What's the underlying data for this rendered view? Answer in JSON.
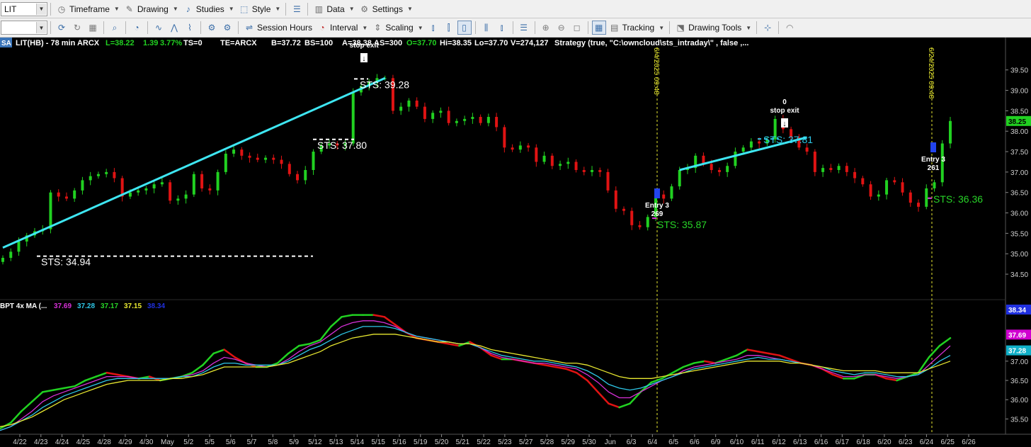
{
  "toolbar1": {
    "symbol_value": "LIT",
    "items": [
      {
        "id": "timeframe",
        "label": "Timeframe",
        "icon": "clock-icon"
      },
      {
        "id": "drawing",
        "label": "Drawing",
        "icon": "pencil-icon"
      },
      {
        "id": "studies",
        "label": "Studies",
        "icon": "studies-icon"
      },
      {
        "id": "style",
        "label": "Style",
        "icon": "style-icon"
      },
      {
        "id": "data",
        "label": "Data",
        "icon": "data-icon"
      },
      {
        "id": "settings",
        "label": "Settings",
        "icon": "gear-icon"
      }
    ]
  },
  "toolbar2": {
    "combo_value": "",
    "session_hours": "Session Hours",
    "interval": "Interval",
    "scaling": "Scaling",
    "tracking": "Tracking",
    "drawing_tools": "Drawing Tools"
  },
  "header": {
    "badge": "SA",
    "symbol": "LIT(HB) - 78 min  ARCX",
    "last": "L=38.22",
    "change": "1.39",
    "change_pct": "3.77%",
    "ts": "TS=0",
    "te": "TE=ARCX",
    "bid": "B=37.72",
    "bid_size": "BS=100",
    "ask": "A=38.38",
    "ask_size": "AS=300",
    "open": "O=37.70",
    "high": "Hi=38.35",
    "low": "Lo=37.70",
    "volume": "V=274,127",
    "strategy": "Strategy (true, \"C:\\owncloud\\sts_intraday\\\" , false ,..."
  },
  "colors": {
    "up": "#21d121",
    "down": "#e01313",
    "trend": "#3ee6f2",
    "green_text": "#28d428",
    "yellow": "#e8e830",
    "blue": "#2244ee",
    "magenta": "#d830d8"
  },
  "chart_data": {
    "type": "candlestick",
    "symbol": "LIT",
    "price_axis": {
      "ticks": [
        "39.50",
        "39.00",
        "38.50",
        "38.00",
        "37.50",
        "37.00",
        "36.50",
        "36.00",
        "35.50",
        "35.00",
        "34.50"
      ],
      "range": [
        34.05,
        40.05
      ],
      "current_price_label": "38.25"
    },
    "indicator_axis": {
      "ticks": [
        "37.00",
        "36.50",
        "36.00",
        "35.50"
      ],
      "range": [
        35.25,
        38.45
      ],
      "value_labels": [
        {
          "value": 38.34,
          "label": "38.34",
          "color": "#2030e0"
        },
        {
          "value": 37.69,
          "label": "37.69",
          "color": "#d000d0"
        },
        {
          "value": 37.28,
          "label": "37.28",
          "color": "#10b0c8"
        }
      ]
    },
    "date_labels": [
      "4/22",
      "4/23",
      "4/24",
      "4/25",
      "4/28",
      "4/29",
      "4/30",
      "May",
      "5/2",
      "5/5",
      "5/6",
      "5/7",
      "5/8",
      "5/9",
      "5/12",
      "5/13",
      "5/14",
      "5/15",
      "5/16",
      "5/19",
      "5/20",
      "5/21",
      "5/22",
      "5/23",
      "5/27",
      "5/28",
      "5/29",
      "5/30",
      "Jun",
      "6/3",
      "6/4",
      "6/5",
      "6/6",
      "6/9",
      "6/10",
      "6/11",
      "6/12",
      "6/13",
      "6/16",
      "6/17",
      "6/18",
      "6/20",
      "6/23",
      "6/24",
      "6/25",
      "6/26"
    ],
    "closes": [
      34.9,
      35.05,
      35.3,
      35.45,
      35.55,
      35.6,
      36.5,
      36.4,
      36.35,
      36.55,
      36.8,
      36.9,
      36.95,
      37.0,
      36.85,
      36.4,
      36.5,
      36.55,
      36.6,
      36.7,
      36.75,
      36.3,
      36.35,
      36.45,
      36.95,
      36.6,
      36.55,
      37.0,
      37.45,
      37.55,
      37.4,
      37.35,
      37.3,
      37.35,
      37.3,
      37.2,
      36.95,
      36.8,
      37.05,
      37.5,
      37.65,
      37.7,
      37.65,
      37.7,
      38.95,
      39.1,
      39.2,
      39.3,
      39.3,
      38.5,
      38.6,
      38.75,
      38.6,
      38.3,
      38.45,
      38.5,
      38.2,
      38.25,
      38.3,
      38.35,
      38.2,
      38.35,
      38.1,
      37.6,
      37.55,
      37.65,
      37.6,
      37.25,
      37.4,
      37.15,
      37.2,
      37.25,
      37.05,
      37.0,
      37.05,
      37.0,
      36.55,
      36.1,
      36.05,
      35.7,
      35.65,
      35.9,
      36.45,
      36.35,
      36.65,
      37.05,
      37.1,
      37.4,
      37.2,
      37.05,
      37.0,
      37.15,
      37.5,
      37.6,
      37.75,
      37.7,
      37.8,
      38.3,
      38.05,
      37.85,
      37.6,
      37.5,
      37.0,
      37.1,
      37.05,
      37.15,
      37.0,
      36.85,
      36.7,
      36.4,
      36.45,
      36.8,
      36.75,
      36.5,
      36.25,
      36.15,
      36.6,
      36.75,
      37.7,
      38.25
    ],
    "annotations": [
      {
        "text": "STS: 34.94",
        "value": 34.94,
        "color": "#ffffff"
      },
      {
        "text": "STS: 37.80",
        "value": 37.8,
        "color": "#ffffff"
      },
      {
        "text": "STS: 39.28",
        "value": 39.28,
        "color": "#ffffff"
      },
      {
        "text": "STS: 35.87",
        "value": 35.87,
        "color": "#28d428"
      },
      {
        "text": "STS: 37.81",
        "value": 37.81,
        "color": "#2ec8e8"
      },
      {
        "text": "STS: 36.36",
        "value": 36.36,
        "color": "#28d428"
      }
    ],
    "signals": [
      {
        "text": "Entry 3",
        "sub": "269"
      },
      {
        "text": "Entry 3",
        "sub": "261"
      },
      {
        "text": "stop exit",
        "sub": "0"
      },
      {
        "text": "stop exit",
        "sub": ""
      }
    ],
    "vertical_markers": [
      {
        "label": "6/4/2025 09:48",
        "color": "#e8e830"
      },
      {
        "label": "6/24/2025 09:48",
        "color": "#e8e830"
      }
    ],
    "indicator": {
      "label": "BPT 4x MA (...",
      "values": [
        {
          "value": "37.69",
          "color": "#d830d8"
        },
        {
          "value": "37.28",
          "color": "#2ec8e8"
        },
        {
          "value": "37.17",
          "color": "#28d428"
        },
        {
          "value": "37.15",
          "color": "#e8e830"
        },
        {
          "value": "38.34",
          "color": "#2030e0"
        }
      ],
      "series": [
        {
          "name": "37.17",
          "color": "#28d428",
          "points": [
            35.25,
            35.4,
            35.7,
            35.95,
            36.2,
            36.25,
            36.3,
            36.35,
            36.5,
            36.6,
            36.7,
            36.65,
            36.6,
            36.55,
            36.6,
            36.5,
            36.55,
            36.6,
            36.7,
            36.9,
            37.2,
            37.3,
            37.1,
            36.95,
            36.85,
            36.85,
            36.95,
            37.2,
            37.4,
            37.45,
            37.55,
            37.9,
            38.15,
            38.2,
            38.2,
            38.2,
            38.15,
            37.95,
            37.75,
            37.6,
            37.55,
            37.5,
            37.45,
            37.4,
            37.5,
            37.35,
            37.15,
            37.05,
            37.05,
            37.0,
            36.95,
            36.9,
            36.85,
            36.8,
            36.7,
            36.5,
            36.2,
            35.9,
            35.8,
            35.9,
            36.2,
            36.45,
            36.55,
            36.7,
            36.85,
            36.95,
            37.0,
            36.95,
            37.05,
            37.15,
            37.3,
            37.25,
            37.2,
            37.15,
            37.05,
            36.95,
            36.9,
            36.8,
            36.65,
            36.55,
            36.55,
            36.65,
            36.65,
            36.55,
            36.5,
            36.6,
            36.7,
            37.1,
            37.4,
            37.6
          ]
        },
        {
          "name": "37.69",
          "color": "#d830d8",
          "points": [
            35.2,
            35.3,
            35.5,
            35.7,
            35.95,
            36.1,
            36.2,
            36.3,
            36.4,
            36.5,
            36.6,
            36.6,
            36.6,
            36.55,
            36.55,
            36.55,
            36.55,
            36.6,
            36.65,
            36.75,
            36.95,
            37.1,
            37.05,
            36.95,
            36.9,
            36.85,
            36.9,
            37.05,
            37.25,
            37.4,
            37.5,
            37.7,
            37.9,
            38.0,
            38.05,
            38.05,
            38.0,
            37.9,
            37.75,
            37.65,
            37.6,
            37.55,
            37.5,
            37.45,
            37.45,
            37.35,
            37.2,
            37.1,
            37.05,
            37.0,
            36.95,
            36.95,
            36.9,
            36.85,
            36.8,
            36.65,
            36.45,
            36.2,
            36.05,
            36.05,
            36.2,
            36.35,
            36.5,
            36.6,
            36.75,
            36.85,
            36.9,
            36.95,
            37.0,
            37.05,
            37.15,
            37.15,
            37.1,
            37.05,
            37.0,
            36.95,
            36.9,
            36.8,
            36.7,
            36.6,
            36.6,
            36.65,
            36.65,
            36.6,
            36.55,
            36.6,
            36.65,
            36.9,
            37.15,
            37.4
          ]
        },
        {
          "name": "37.28",
          "color": "#2ec8e8",
          "points": [
            35.2,
            35.3,
            35.45,
            35.6,
            35.8,
            35.95,
            36.1,
            36.2,
            36.3,
            36.4,
            36.5,
            36.55,
            36.55,
            36.55,
            36.55,
            36.55,
            36.55,
            36.6,
            36.6,
            36.7,
            36.85,
            36.95,
            36.95,
            36.9,
            36.9,
            36.9,
            36.9,
            37.0,
            37.15,
            37.3,
            37.4,
            37.55,
            37.7,
            37.8,
            37.9,
            37.9,
            37.9,
            37.85,
            37.75,
            37.65,
            37.6,
            37.55,
            37.5,
            37.45,
            37.45,
            37.35,
            37.25,
            37.15,
            37.1,
            37.05,
            37.0,
            37.0,
            36.95,
            36.9,
            36.85,
            36.75,
            36.6,
            36.4,
            36.3,
            36.25,
            36.3,
            36.4,
            36.5,
            36.6,
            36.7,
            36.8,
            36.85,
            36.9,
            36.95,
            37.0,
            37.05,
            37.1,
            37.05,
            37.05,
            37.0,
            36.95,
            36.9,
            36.85,
            36.75,
            36.7,
            36.65,
            36.7,
            36.7,
            36.65,
            36.6,
            36.6,
            36.65,
            36.8,
            37.0,
            37.15
          ]
        },
        {
          "name": "37.15",
          "color": "#e8e830",
          "points": [
            35.3,
            35.35,
            35.45,
            35.55,
            35.7,
            35.85,
            36.0,
            36.1,
            36.2,
            36.3,
            36.4,
            36.45,
            36.5,
            36.5,
            36.5,
            36.5,
            36.55,
            36.55,
            36.6,
            36.65,
            36.75,
            36.85,
            36.85,
            36.85,
            36.85,
            36.85,
            36.9,
            36.95,
            37.05,
            37.15,
            37.25,
            37.4,
            37.5,
            37.6,
            37.65,
            37.7,
            37.7,
            37.7,
            37.65,
            37.6,
            37.55,
            37.5,
            37.5,
            37.45,
            37.45,
            37.4,
            37.3,
            37.25,
            37.2,
            37.15,
            37.1,
            37.05,
            37.0,
            36.95,
            36.95,
            36.9,
            36.8,
            36.7,
            36.6,
            36.55,
            36.55,
            36.55,
            36.6,
            36.65,
            36.7,
            36.75,
            36.8,
            36.85,
            36.9,
            36.95,
            37.0,
            37.0,
            37.0,
            37.0,
            36.95,
            36.95,
            36.9,
            36.85,
            36.8,
            36.75,
            36.75,
            36.75,
            36.75,
            36.7,
            36.7,
            36.7,
            36.7,
            36.8,
            36.9,
            37.0
          ]
        }
      ]
    }
  }
}
